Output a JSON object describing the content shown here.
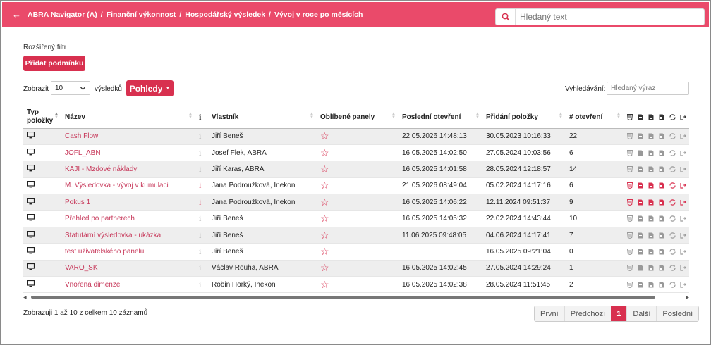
{
  "header": {
    "breadcrumbs": [
      "ABRA Navigator (A)",
      "Finanční výkonnost",
      "Hospodářský výsledek",
      "Vývoj v roce po měsících"
    ],
    "search_placeholder": "Hledaný text",
    "color": "#ea4a6a"
  },
  "toolbar": {
    "filter_label": "Rozšířený filtr",
    "add_condition_label": "Přidat podmínku",
    "show_label": "Zobrazit",
    "page_size": "10",
    "results_label": "výsledků",
    "views_label": "Pohledy",
    "search_label": "Vyhledávání:",
    "search_placeholder": "Hledaný výraz",
    "accent": "#d8304f"
  },
  "table": {
    "columns": {
      "type": "Typ položky",
      "name": "Název",
      "info": "i",
      "owner": "Vlastník",
      "favorite": "Oblíbené panely",
      "last_open": "Poslední otevření",
      "added": "Přidání položky",
      "opens": "# otevření"
    },
    "rows": [
      {
        "name": "Cash Flow",
        "info_active": false,
        "owner": "Jiří Beneš",
        "last_open": "22.05.2026 14:48:13",
        "added": "30.05.2023 10:16:33",
        "opens": "22",
        "actions_active": false
      },
      {
        "name": "JOFL_ABN",
        "info_active": false,
        "owner": "Josef Flek, ABRA",
        "last_open": "16.05.2025 14:02:50",
        "added": "27.05.2024 10:03:56",
        "opens": "6",
        "actions_active": false
      },
      {
        "name": "KAJI - Mzdové náklady",
        "info_active": false,
        "owner": "Jiří Karas, ABRA",
        "last_open": "16.05.2025 14:01:58",
        "added": "28.05.2024 12:18:57",
        "opens": "14",
        "actions_active": false
      },
      {
        "name": "M. Výsledovka - vývoj v kumulaci",
        "info_active": true,
        "owner": "Jana Podroužková, Inekon",
        "last_open": "21.05.2026 08:49:04",
        "added": "05.02.2024 14:17:16",
        "opens": "6",
        "actions_active": true
      },
      {
        "name": "Pokus 1",
        "info_active": true,
        "owner": "Jana Podroužková, Inekon",
        "last_open": "16.05.2025 14:06:22",
        "added": "12.11.2024 09:51:37",
        "opens": "9",
        "actions_active": true
      },
      {
        "name": "Přehled po partnerech",
        "info_active": false,
        "owner": "Jiří Beneš",
        "last_open": "16.05.2025 14:05:32",
        "added": "22.02.2024 14:43:44",
        "opens": "10",
        "actions_active": false
      },
      {
        "name": "Statutární výsledovka - ukázka",
        "info_active": false,
        "owner": "Jiří Beneš",
        "last_open": "11.06.2025 09:48:05",
        "added": "04.06.2024 14:17:41",
        "opens": "7",
        "actions_active": false
      },
      {
        "name": "test uživatelského panelu",
        "info_active": false,
        "owner": "Jiří Beneš",
        "last_open": "",
        "added": "16.05.2025 09:21:04",
        "opens": "0",
        "actions_active": false
      },
      {
        "name": "VARO_SK",
        "info_active": false,
        "owner": "Václav Rouha, ABRA",
        "last_open": "16.05.2025 14:02:45",
        "added": "27.05.2024 14:29:24",
        "opens": "1",
        "actions_active": false
      },
      {
        "name": "Vnořená dimenze",
        "info_active": false,
        "owner": "Robin Horký, Inekon",
        "last_open": "16.05.2025 14:02:38",
        "added": "28.05.2024 11:51:45",
        "opens": "2",
        "actions_active": false
      }
    ]
  },
  "footer": {
    "summary": "Zobrazuji 1 až 10 z celkem 10 záznamů",
    "pager": {
      "first": "První",
      "prev": "Předchozí",
      "current": "1",
      "next": "Další",
      "last": "Poslední"
    }
  }
}
